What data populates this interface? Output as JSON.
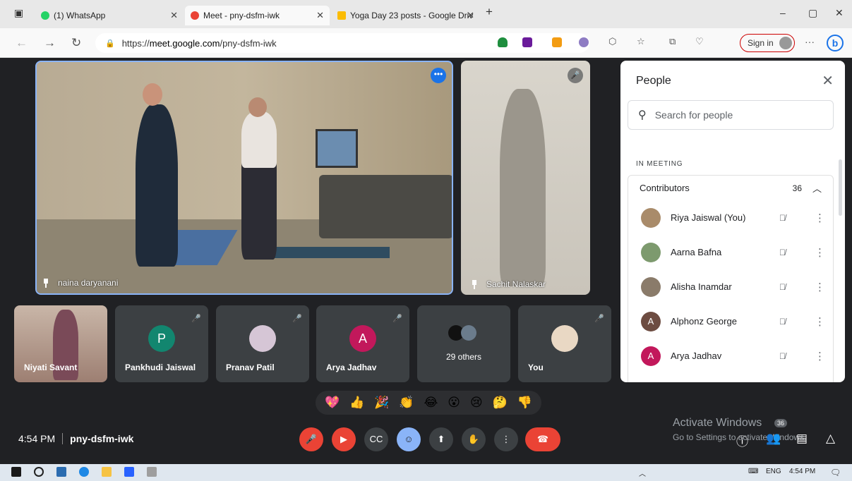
{
  "browser": {
    "tabs": [
      {
        "title": "(1) WhatsApp",
        "color": "#25d366"
      },
      {
        "title": "Meet - pny-dsfm-iwk",
        "color": "#ea4335"
      },
      {
        "title": "Yoga Day 23 posts - Google Driv",
        "color": "#fbbc04"
      }
    ],
    "url_prefix": "https://",
    "url_host": "meet.google.com",
    "url_path": "/pny-dsfm-iwk",
    "sign_in_label": "Sign in",
    "new_tab_icon": "+",
    "min_icon": "–",
    "restore_icon": "▢",
    "close_icon": "✕"
  },
  "meeting": {
    "main_tile_name": "naina daryanani",
    "side_tile_name": "Sachit Nalaskar",
    "thumbnails": [
      {
        "name": "Niyati Savant",
        "initial": "",
        "color": "#8b6b5a"
      },
      {
        "name": "Pankhudi Jaiswal",
        "initial": "P",
        "color": "#12866f"
      },
      {
        "name": "Pranav Patil",
        "initial": "",
        "color": "#d6c6d6"
      },
      {
        "name": "Arya Jadhav",
        "initial": "A",
        "color": "#c2185b"
      },
      {
        "name": "29 others",
        "initial": "",
        "color": "#3c4043"
      },
      {
        "name": "You",
        "initial": "",
        "color": "#e9d8c4"
      }
    ],
    "time": "4:54 PM",
    "meeting_code": "pny-dsfm-iwk",
    "reactions": [
      "💖",
      "👍",
      "🎉",
      "👏",
      "😂",
      "😮",
      "😢",
      "🤔",
      "👎"
    ]
  },
  "people_panel": {
    "title": "People",
    "search_placeholder": "Search for people",
    "section_label": "IN MEETING",
    "group_label": "Contributors",
    "group_count": "36",
    "participants": [
      {
        "name": "Riya Jaiswal (You)",
        "initial": "",
        "color": "#a98b6a"
      },
      {
        "name": "Aarna Bafna",
        "initial": "",
        "color": "#7d9a6e"
      },
      {
        "name": "Alisha Inamdar",
        "initial": "",
        "color": "#8a7b6a"
      },
      {
        "name": "Alphonz George",
        "initial": "A",
        "color": "#6d4c41"
      },
      {
        "name": "Arya Jadhav",
        "initial": "A",
        "color": "#c2185b"
      }
    ]
  },
  "overlay": {
    "activate_title": "Activate Windows",
    "activate_sub": "Go to Settings to activate Windows.",
    "people_badge": "36"
  },
  "taskbar": {
    "lang": "ENG",
    "time": "4:54 PM"
  }
}
